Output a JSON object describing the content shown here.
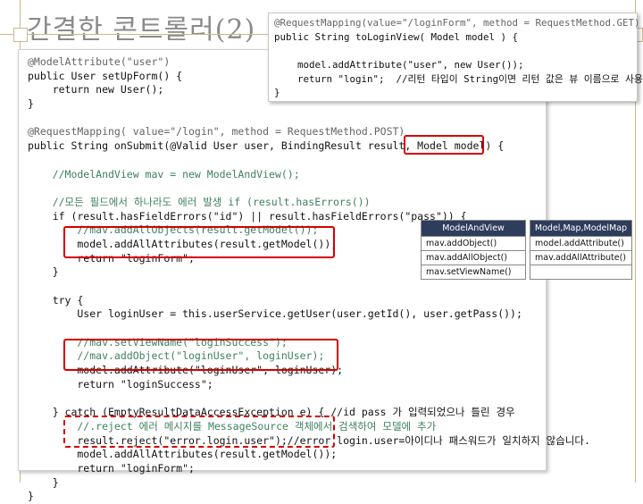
{
  "slide": {
    "title": "간결한 콘트롤러(2)"
  },
  "colors": {
    "highlight": "#d40000",
    "header_bg": "#2f3d5c",
    "decoration": "#c9b98d"
  },
  "top_snippet": {
    "lines": [
      "@RequestMapping(value=\"/loginForm\", method = RequestMethod.GET)",
      "public String toLoginView( Model model ) {",
      "",
      "    model.addAttribute(\"user\", new User());",
      "    return \"login\";  //리턴 타입이 String이면 리턴 값은 뷰 이름으로 사용",
      "}"
    ]
  },
  "main_code": {
    "lines": [
      "@ModelAttribute(\"user\")",
      "public User setUpForm() {",
      "    return new User();",
      "}",
      "",
      "@RequestMapping( value=\"/login\", method = RequestMethod.POST)",
      "public String onSubmit(@Valid User user, BindingResult result, Model model) {",
      "",
      "    //ModelAndView mav = new ModelAndView();",
      "",
      "    //모든 필드에서 하나라도 에러 발생 if (result.hasErrors())",
      "    if (result.hasFieldErrors(\"id\") || result.hasFieldErrors(\"pass\")) {",
      "        //mav.addAllObjects(result.getModel());",
      "        model.addAllAttributes(result.getModel());",
      "        return \"loginForm\";",
      "    }",
      "",
      "    try {",
      "        User loginUser = this.userService.getUser(user.getId(), user.getPass());",
      "",
      "        //mav.setViewName(\"loginSuccess\");",
      "        //mav.addObject(\"loginUser\", loginUser);",
      "        model.addAttribute(\"loginUser\", loginUser);",
      "        return \"loginSuccess\";",
      "",
      "    } catch (EmptyResultDataAccessException e) { //id pass 가 입력되었으나 틀린 경우",
      "        //.reject 에러 메시지를 MessageSource 객체에서 검색하여 모델에 추가",
      "        result.reject(\"error.login.user\");//error.login.user=아이디나 패스워드가 일치하지 않습니다.",
      "        model.addAllAttributes(result.getModel());",
      "        return \"loginForm\";",
      "    }",
      "}"
    ]
  },
  "table_mav": {
    "header": "ModelAndView",
    "rows": [
      "mav.addObject()",
      "mav.addAllObject()",
      "mav.setViewName()"
    ]
  },
  "table_model": {
    "header": "Model,Map,ModelMap",
    "rows": [
      "model.addAttribute()",
      "mav.addAllAttribute()",
      ""
    ]
  }
}
